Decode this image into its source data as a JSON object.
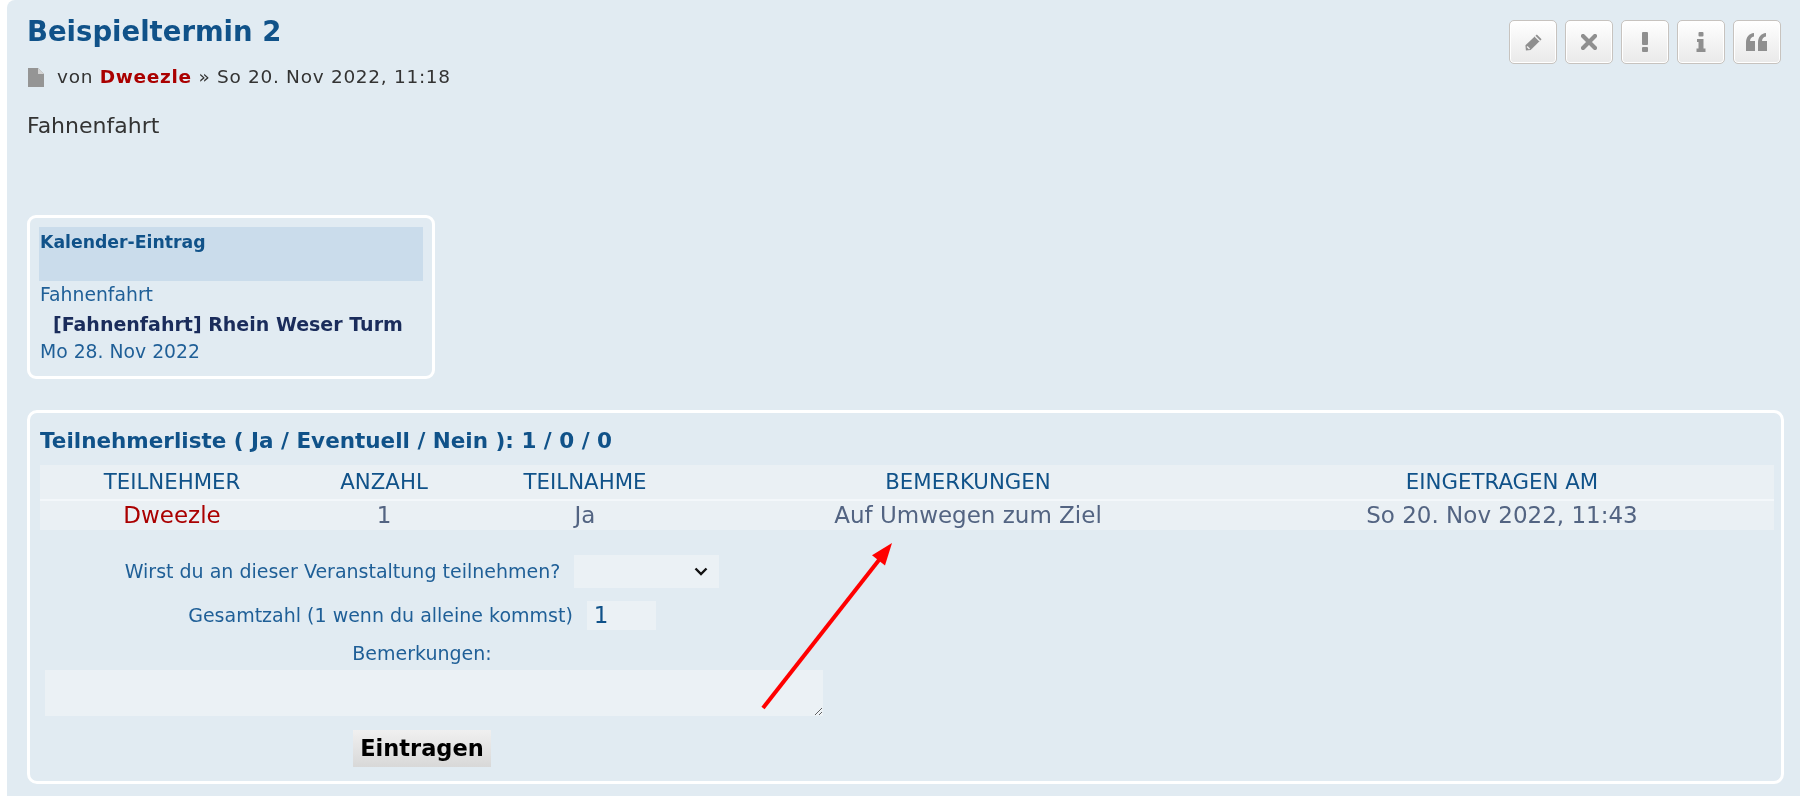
{
  "post": {
    "title": "Beispieltermin 2",
    "byline": {
      "prefix": "von",
      "author": "Dweezle",
      "suffix": "» So 20. Nov 2022, 11:18"
    },
    "body": "Fahnenfahrt"
  },
  "calendar_entry": {
    "heading": "Kalender-Eintrag",
    "category": "Fahnenfahrt",
    "event": "[Fahnenfahrt] Rhein Weser Turm",
    "date": "Mo 28. Nov 2022"
  },
  "participants": {
    "title": "Teilnehmerliste ( Ja / Eventuell / Nein ): 1 / 0 / 0",
    "columns": [
      "TEILNEHMER",
      "ANZAHL",
      "TEILNAHME",
      "BEMERKUNGEN",
      "EINGETRAGEN AM"
    ],
    "rows": [
      {
        "participant": "Dweezle",
        "count": "1",
        "attendance": "Ja",
        "remarks": "Auf Umwegen zum Ziel",
        "registered": "So 20. Nov 2022, 11:43"
      }
    ]
  },
  "signup_form": {
    "attendance_question": "Wirst du an dieser Veranstaltung teilnehmen?",
    "count_label": "Gesamtzahl (1 wenn du alleine kommst)",
    "count_field": {
      "value": "1"
    },
    "remarks_label": "Bemerkungen:",
    "submit_button": "Eintragen"
  }
}
